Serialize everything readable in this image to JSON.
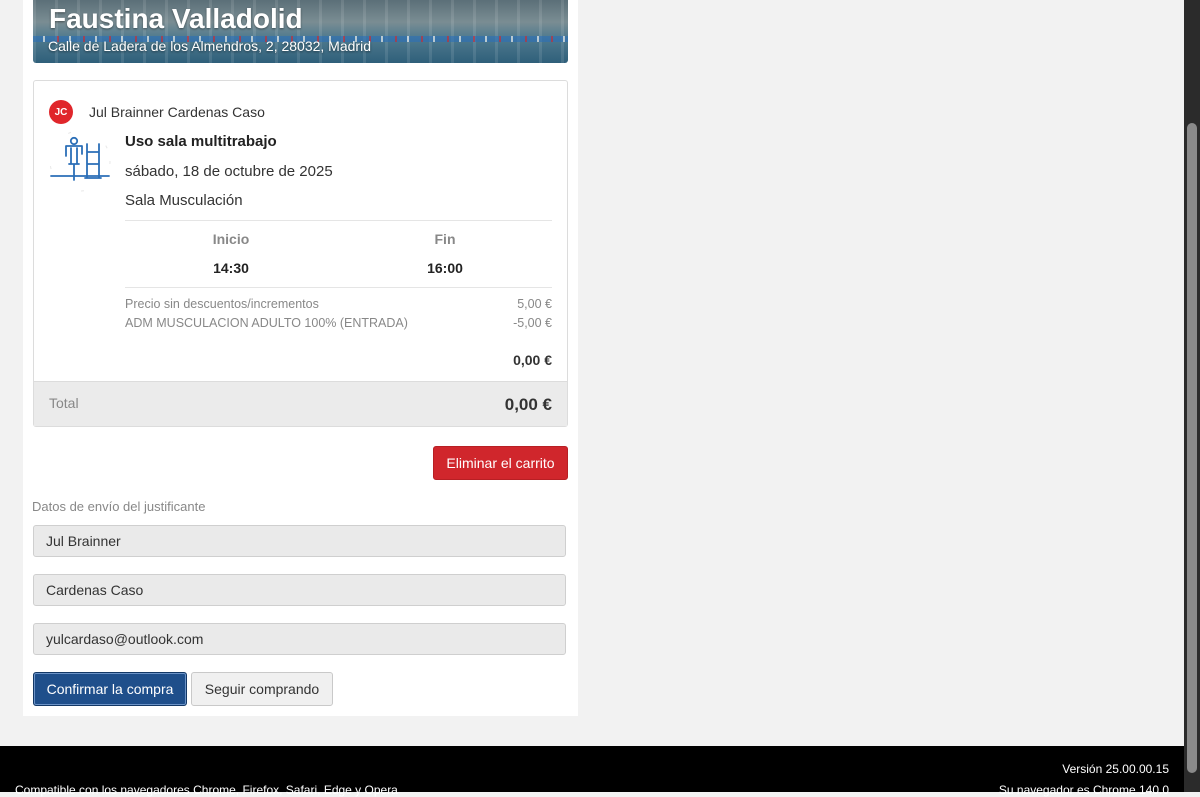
{
  "center": {
    "name": "Faustina Valladolid",
    "address": "Calle de Ladera de los Almendros, 2, 28032, Madrid"
  },
  "cart": {
    "user_initials": "JC",
    "user_name": "Jul Brainner Cardenas Caso",
    "activity_title": "Uso sala multitrabajo",
    "activity_date": "sábado, 18 de octubre de 2025",
    "activity_room": "Sala Musculación",
    "start_label": "Inicio",
    "end_label": "Fin",
    "start_time": "14:30",
    "end_time": "16:00",
    "price_lines": [
      {
        "label": "Precio sin descuentos/incrementos",
        "amount": "5,00 €"
      },
      {
        "label": "ADM MUSCULACION ADULTO 100% (ENTRADA)",
        "amount": "-5,00 €"
      }
    ],
    "subtotal": "0,00 €",
    "total_label": "Total",
    "total_value": "0,00 €"
  },
  "actions": {
    "delete_cart": "Eliminar el carrito",
    "confirm": "Confirmar la compra",
    "continue": "Seguir comprando"
  },
  "shipping": {
    "section_label": "Datos de envío del justificante",
    "first_name": "Jul Brainner",
    "last_name": "Cardenas Caso",
    "email": "yulcardaso@outlook.com"
  },
  "footer": {
    "version": "Versión 25.00.00.15",
    "compat": "Compatible con los navegadores Chrome, Firefox, Safari, Edge y Opera",
    "browser": "Su navegador es Chrome 140.0"
  },
  "icons": {
    "activity": "gym-station-icon"
  },
  "colors": {
    "primary": "#1f4f8b",
    "danger": "#d0262c",
    "avatar": "#e0262b"
  }
}
